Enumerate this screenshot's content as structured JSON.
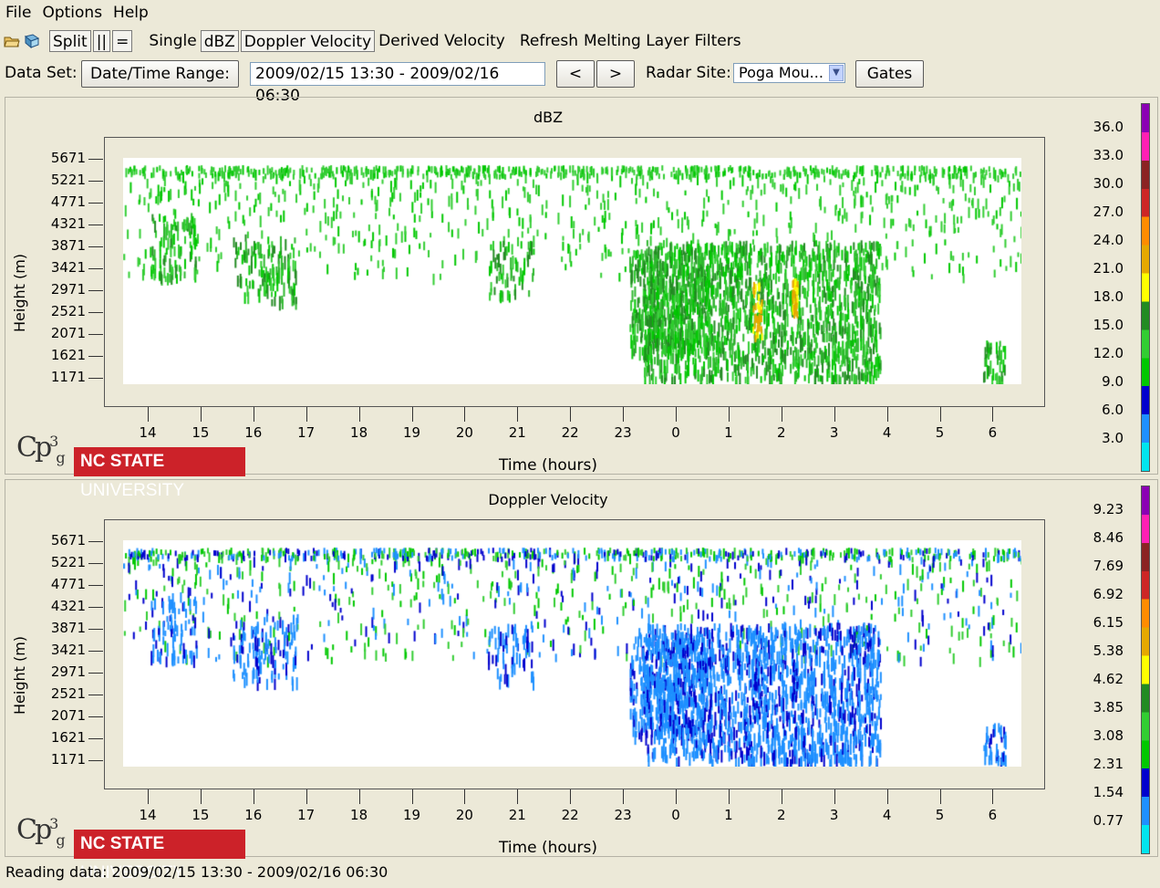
{
  "menu": [
    "File",
    "Options",
    "Help"
  ],
  "toolbar": {
    "split": "Split",
    "pipe": "||",
    "equals": "=",
    "single": "Single",
    "dbz": "dBZ",
    "doppler": "Doppler Velocity",
    "derived": "Derived Velocity",
    "refresh": "Refresh",
    "melting": "Melting Layer",
    "filters": "Filters"
  },
  "dataset": {
    "label": "Data Set:",
    "range_button": "Date/Time Range:",
    "range_value": "2009/02/15 13:30 - 2009/02/16 06:30",
    "prev": "<",
    "next": ">",
    "site_label": "Radar Site:",
    "site_value": "Poga Mou...",
    "gates": "Gates"
  },
  "panels": [
    {
      "title": "dBZ",
      "ylabel": "Height (m)",
      "xlabel": "Time (hours)",
      "yticks": [
        "5671",
        "5221",
        "4771",
        "4321",
        "3871",
        "3421",
        "2971",
        "2521",
        "2071",
        "1621",
        "1171"
      ],
      "xticks": [
        "14",
        "15",
        "16",
        "17",
        "18",
        "19",
        "20",
        "21",
        "22",
        "23",
        "0",
        "1",
        "2",
        "3",
        "4",
        "5",
        "6"
      ],
      "colorbar": [
        "36.0",
        "33.0",
        "30.0",
        "27.0",
        "24.0",
        "21.0",
        "18.0",
        "15.0",
        "12.0",
        "9.0",
        "6.0",
        "3.0"
      ]
    },
    {
      "title": "Doppler Velocity",
      "ylabel": "Height (m)",
      "xlabel": "Time (hours)",
      "yticks": [
        "5671",
        "5221",
        "4771",
        "4321",
        "3871",
        "3421",
        "2971",
        "2521",
        "2071",
        "1621",
        "1171"
      ],
      "xticks": [
        "14",
        "15",
        "16",
        "17",
        "18",
        "19",
        "20",
        "21",
        "22",
        "23",
        "0",
        "1",
        "2",
        "3",
        "4",
        "5",
        "6"
      ],
      "colorbar": [
        "9.23",
        "8.46",
        "7.69",
        "6.92",
        "6.15",
        "5.38",
        "4.62",
        "3.85",
        "3.08",
        "2.31",
        "1.54",
        "0.77"
      ]
    }
  ],
  "logos": {
    "cp3": "Cp3g",
    "ncsu_bold": "NC STATE",
    "ncsu_rest": "UNIVERSITY"
  },
  "colors": {
    "colorbar_top_to_bottom": [
      "#8b00b4",
      "#ff1fb4",
      "#8b2323",
      "#cd2626",
      "#ff8c00",
      "#e6a800",
      "#ffff00",
      "#228b22",
      "#32cd32",
      "#00c800",
      "#0000cd",
      "#1e90ff",
      "#00e5ee"
    ]
  },
  "status": "Reading data: 2009/02/15 13:30 - 2009/02/16 06:30"
}
